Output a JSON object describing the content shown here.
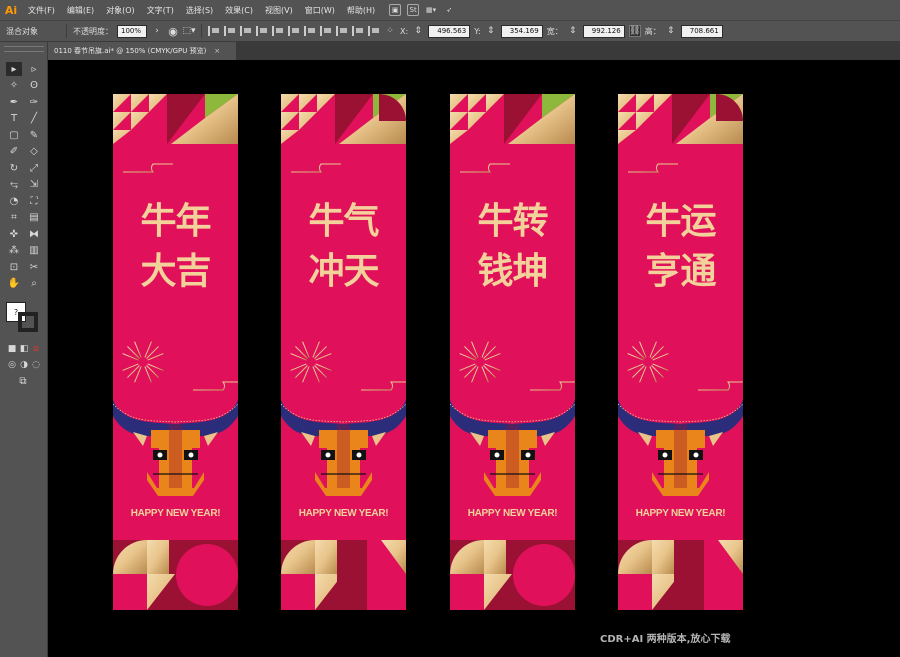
{
  "app": {
    "logo": "Ai",
    "menus": [
      "文件(F)",
      "编辑(E)",
      "对象(O)",
      "文字(T)",
      "选择(S)",
      "效果(C)",
      "视图(V)",
      "窗口(W)",
      "帮助(H)"
    ],
    "menu_icons": [
      "bridge-icon",
      "stock-icon",
      "arrange-documents-icon",
      "gpu-icon"
    ]
  },
  "control_bar": {
    "selection_label": "混合对象",
    "opacity_label": "不透明度：",
    "opacity_value": "100%",
    "x_label": "X:",
    "x_value": "496.563 ",
    "y_label": "Y:",
    "y_value": "354.169 ",
    "w_label": "宽：",
    "w_value": "992.126 ",
    "h_label": "高：",
    "h_value": "708.661 "
  },
  "document_tab": {
    "title": "0110 春节吊旗.ai* @ 150% (CMYK/GPU 预览)",
    "close": "×"
  },
  "toolbar": {
    "fill_label": "?",
    "tools": [
      "selection-tool",
      "direct-selection-tool",
      "magic-wand-tool",
      "lasso-tool",
      "pen-tool",
      "curvature-tool",
      "type-tool",
      "line-tool",
      "rectangle-tool",
      "paintbrush-tool",
      "shaper-tool",
      "eraser-tool",
      "rotate-tool",
      "scale-tool",
      "width-tool",
      "free-transform-tool",
      "shape-builder-tool",
      "perspective-grid-tool",
      "mesh-tool",
      "gradient-tool",
      "eyedropper-tool",
      "blend-tool",
      "symbol-sprayer-tool",
      "column-graph-tool",
      "artboard-tool",
      "slice-tool",
      "hand-tool",
      "zoom-tool"
    ]
  },
  "banners": [
    {
      "line1": "牛年",
      "line2": "大吉",
      "tagline": "HAPPY NEW YEAR!"
    },
    {
      "line1": "牛气",
      "line2": "冲天",
      "tagline": "HAPPY NEW YEAR!"
    },
    {
      "line1": "牛转",
      "line2": "钱坤",
      "tagline": "HAPPY NEW YEAR!"
    },
    {
      "line1": "牛运",
      "line2": "亨通",
      "tagline": "HAPPY NEW YEAR!"
    }
  ],
  "watermark": "CDR+AI 两种版本,放心下载",
  "colors": {
    "banner_red": "#e0105a",
    "dark_red": "#9a1133",
    "gold": "#e8c48a",
    "green": "#8db83c",
    "navy": "#2c2d7a",
    "orange": "#e9851a"
  }
}
